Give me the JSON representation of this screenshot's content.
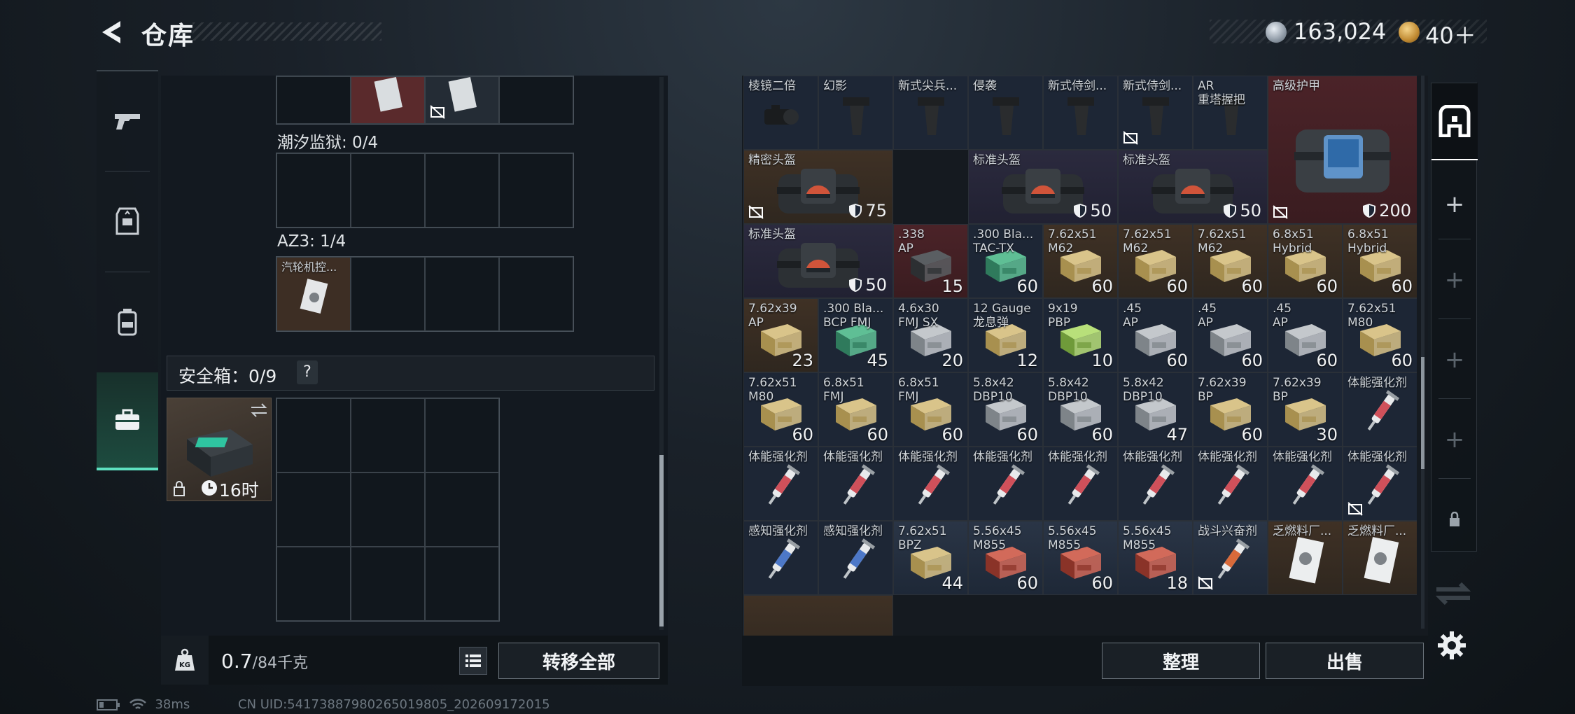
{
  "header": {
    "title": "仓库",
    "currency1": "163,024",
    "currency2": "40＋"
  },
  "left": {
    "section1": "潮汐监狱: 0/4",
    "section2": "AZ3: 1/4",
    "az3_item": "汽轮机控...",
    "safebox_label": "安全箱：0/9",
    "help": "?",
    "case_timer": "16时",
    "weight": "0.7",
    "weight_unit": "/84千克",
    "transfer_all": "转移全部"
  },
  "right": {
    "sort": "整理",
    "sell": "出售"
  },
  "status": {
    "ping": "38ms",
    "uid": "CN UID:54173887980265019805_202609172015"
  },
  "cells": [
    {
      "name": "棱镜二倍",
      "qty": "",
      "type": "scope",
      "color": "default"
    },
    {
      "name": "幻影",
      "qty": "",
      "type": "grip",
      "color": "default"
    },
    {
      "name": "新式尖兵...",
      "qty": "",
      "type": "grip",
      "color": "default"
    },
    {
      "name": "侵袭",
      "qty": "",
      "type": "grip",
      "color": "default"
    },
    {
      "name": "新式侍剑...",
      "qty": "",
      "type": "grip",
      "color": "default"
    },
    {
      "name": "新式侍剑...",
      "qty": "",
      "type": "grip",
      "color": "default",
      "nosell": true
    },
    {
      "name": "AR\n重塔握把",
      "qty": "",
      "type": "grip",
      "color": "default"
    },
    {
      "name": "高级护甲",
      "qty": "",
      "armor": "200",
      "type": "armor",
      "color": "red",
      "nosell": true
    },
    {
      "name": "精密头盔",
      "qty": "",
      "armor": "75",
      "type": "helmet",
      "color": "tan",
      "nosell": true
    },
    {
      "name": "标准头盔",
      "qty": "",
      "armor": "50",
      "type": "helmet",
      "color": "purple"
    },
    {
      "name": "标准头盔",
      "qty": "",
      "armor": "50",
      "type": "helmet",
      "color": "purple"
    },
    {
      "name": "标准头盔",
      "qty": "",
      "armor": "50",
      "type": "helmet",
      "color": "purple"
    },
    {
      "name": ".338\nAP",
      "qty": "15",
      "type": "ammo-dark",
      "color": "red"
    },
    {
      "name": ".300 Bla...\nTAC-TX",
      "qty": "60",
      "type": "ammo-green",
      "color": "default"
    },
    {
      "name": "7.62x51\nM62",
      "qty": "60",
      "type": "ammo-tan",
      "color": "tan"
    },
    {
      "name": "7.62x51\nM62",
      "qty": "60",
      "type": "ammo-tan",
      "color": "tan"
    },
    {
      "name": "7.62x51\nM62",
      "qty": "60",
      "type": "ammo-tan",
      "color": "tan"
    },
    {
      "name": "6.8x51\nHybrid",
      "qty": "60",
      "type": "ammo-tan",
      "color": "tan"
    },
    {
      "name": "6.8x51\nHybrid",
      "qty": "60",
      "type": "ammo-tan",
      "color": "tan"
    },
    {
      "name": "7.62x39\nAP",
      "qty": "23",
      "type": "ammo-tan",
      "color": "tan"
    },
    {
      "name": ".300 Bla...\nBCP FMJ",
      "qty": "45",
      "type": "ammo-green",
      "color": "default"
    },
    {
      "name": "4.6x30\nFMJ SX",
      "qty": "20",
      "type": "ammo-grey",
      "color": "default"
    },
    {
      "name": "12 Gauge\n龙息弹",
      "qty": "12",
      "type": "ammo-tan",
      "color": "default"
    },
    {
      "name": "9x19\nPBP",
      "qty": "10",
      "type": "ammo-lime",
      "color": "default"
    },
    {
      "name": ".45\nAP",
      "qty": "60",
      "type": "ammo-grey",
      "color": "default"
    },
    {
      "name": ".45\nAP",
      "qty": "60",
      "type": "ammo-grey",
      "color": "default"
    },
    {
      "name": ".45\nAP",
      "qty": "60",
      "type": "ammo-grey",
      "color": "default"
    },
    {
      "name": "7.62x51\nM80",
      "qty": "60",
      "type": "ammo-tan",
      "color": "default"
    },
    {
      "name": "7.62x51\nM80",
      "qty": "60",
      "type": "ammo-tan",
      "color": "default"
    },
    {
      "name": "6.8x51\nFMJ",
      "qty": "60",
      "type": "ammo-tan",
      "color": "default"
    },
    {
      "name": "6.8x51\nFMJ",
      "qty": "60",
      "type": "ammo-tan",
      "color": "default"
    },
    {
      "name": "5.8x42\nDBP10",
      "qty": "60",
      "type": "ammo-grey",
      "color": "default"
    },
    {
      "name": "5.8x42\nDBP10",
      "qty": "60",
      "type": "ammo-grey",
      "color": "default"
    },
    {
      "name": "5.8x42\nDBP10",
      "qty": "47",
      "type": "ammo-grey",
      "color": "default"
    },
    {
      "name": "7.62x39\nBP",
      "qty": "60",
      "type": "ammo-tan",
      "color": "default"
    },
    {
      "name": "7.62x39\nBP",
      "qty": "30",
      "type": "ammo-tan",
      "color": "default"
    },
    {
      "name": "体能强化剂",
      "qty": "",
      "type": "syringe-red",
      "color": "default"
    },
    {
      "name": "体能强化剂",
      "qty": "",
      "type": "syringe-red",
      "color": "default"
    },
    {
      "name": "体能强化剂",
      "qty": "",
      "type": "syringe-red",
      "color": "default"
    },
    {
      "name": "体能强化剂",
      "qty": "",
      "type": "syringe-red",
      "color": "default"
    },
    {
      "name": "体能强化剂",
      "qty": "",
      "type": "syringe-red",
      "color": "default"
    },
    {
      "name": "体能强化剂",
      "qty": "",
      "type": "syringe-red",
      "color": "default"
    },
    {
      "name": "体能强化剂",
      "qty": "",
      "type": "syringe-red",
      "color": "default"
    },
    {
      "name": "体能强化剂",
      "qty": "",
      "type": "syringe-red",
      "color": "default"
    },
    {
      "name": "体能强化剂",
      "qty": "",
      "type": "syringe-red",
      "color": "default"
    },
    {
      "name": "体能强化剂",
      "qty": "",
      "type": "syringe-red",
      "color": "default",
      "nosell": true
    },
    {
      "name": "感知强化剂",
      "qty": "",
      "type": "syringe-blue",
      "color": "default"
    },
    {
      "name": "感知强化剂",
      "qty": "",
      "type": "syringe-blue",
      "color": "default"
    },
    {
      "name": "7.62x51\nBPZ",
      "qty": "44",
      "type": "ammo-tan",
      "color": "blue"
    },
    {
      "name": "5.56x45\nM855",
      "qty": "60",
      "type": "ammo-red",
      "color": "blue"
    },
    {
      "name": "5.56x45\nM855",
      "qty": "60",
      "type": "ammo-red",
      "color": "blue"
    },
    {
      "name": "5.56x45\nM855",
      "qty": "18",
      "type": "ammo-red",
      "color": "blue"
    },
    {
      "name": "战斗兴奋剂",
      "qty": "",
      "type": "syringe-orange",
      "color": "blue",
      "nosell": true
    },
    {
      "name": "乏燃料厂...",
      "qty": "",
      "type": "doc",
      "color": "tan"
    },
    {
      "name": "乏燃料厂...",
      "qty": "",
      "type": "doc",
      "color": "tan"
    },
    {
      "name": "",
      "qty": "",
      "type": "crate",
      "color": "tan"
    }
  ]
}
